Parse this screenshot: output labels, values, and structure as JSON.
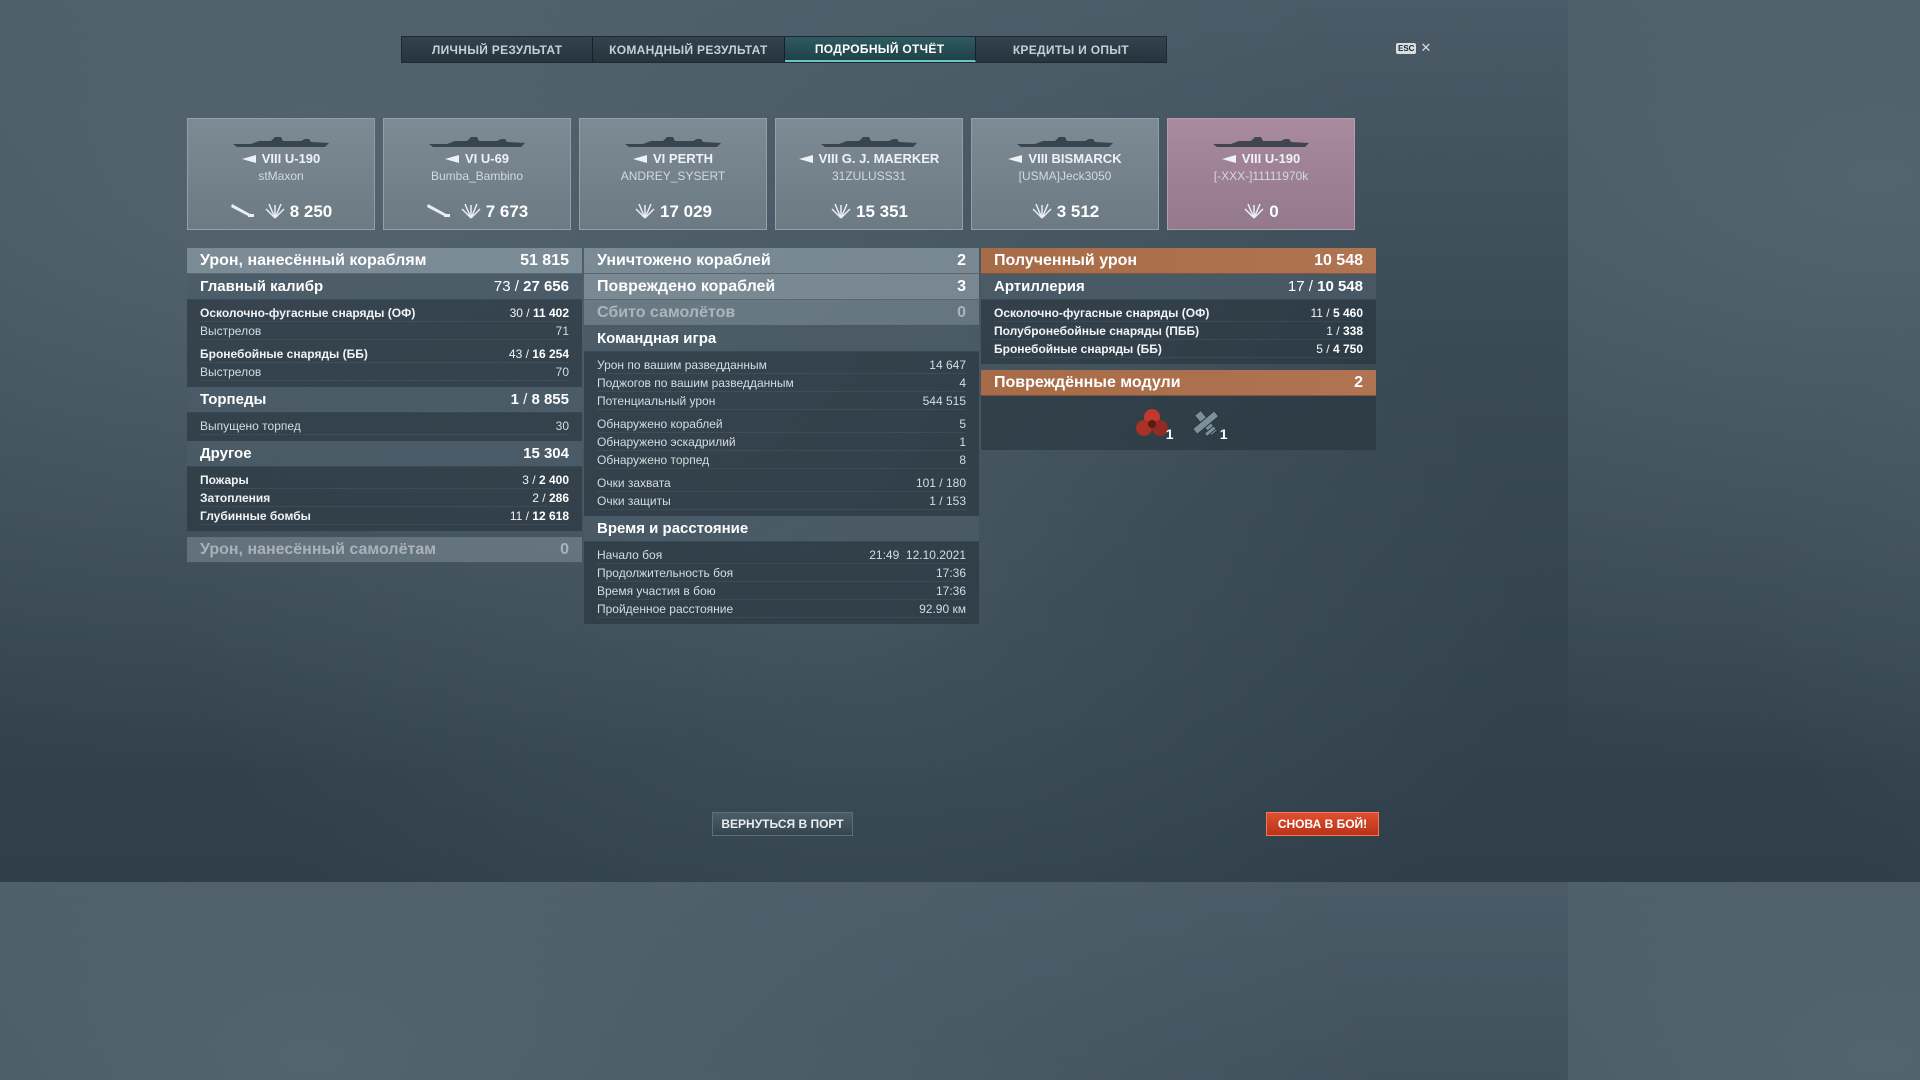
{
  "tabs": [
    "ЛИЧНЫЙ РЕЗУЛЬТАТ",
    "КОМАНДНЫЙ РЕЗУЛЬТАТ",
    "ПОДРОБНЫЙ ОТЧЁТ",
    "КРЕДИТЫ И ОПЫТ"
  ],
  "active_tab": "ПОДРОБНЫЙ ОТЧЁТ",
  "esc": {
    "badge": "ESC",
    "close": "✕"
  },
  "cards": [
    {
      "ship": "VIII U-190",
      "player": "stMaxon",
      "damage": "8 250",
      "own": false,
      "torpedo_icon": true
    },
    {
      "ship": "VI U-69",
      "player": "Bumba_Bambino",
      "damage": "7 673",
      "own": false,
      "torpedo_icon": true
    },
    {
      "ship": "VI PERTH",
      "player": "ANDREY_SYSERT",
      "damage": "17 029",
      "own": false,
      "torpedo_icon": false
    },
    {
      "ship": "VIII G. J. MAERKER",
      "player": "31ZULUSS31",
      "damage": "15 351",
      "own": false,
      "torpedo_icon": false
    },
    {
      "ship": "VIII BISMARCK",
      "player": "[USMA]Jeck3050",
      "damage": "3 512",
      "own": false,
      "torpedo_icon": false
    },
    {
      "ship": "VIII U-190",
      "player": "[-XXX-]11111970k",
      "damage": "0",
      "own": true,
      "torpedo_icon": false
    }
  ],
  "col1": {
    "ships_dmg": {
      "label": "Урон, нанесённый кораблям",
      "value": "51 815"
    },
    "main": {
      "label": "Главный калибр",
      "hits": "73",
      "value": "27 656"
    },
    "he": {
      "label": "Осколочно-фугасные снаряды (ОФ)",
      "hits": "30",
      "value": "11 402"
    },
    "he_shots": {
      "label": "Выстрелов",
      "value": "71"
    },
    "ap": {
      "label": "Бронебойные снаряды (ББ)",
      "hits": "43",
      "value": "16 254"
    },
    "ap_shots": {
      "label": "Выстрелов",
      "value": "70"
    },
    "torp": {
      "label": "Торпеды",
      "hits": "1",
      "value": "8 855"
    },
    "torp_launched": {
      "label": "Выпущено торпед",
      "value": "30"
    },
    "other": {
      "label": "Другое",
      "value": "15 304"
    },
    "fires": {
      "label": "Пожары",
      "hits": "3",
      "value": "2 400"
    },
    "floods": {
      "label": "Затопления",
      "hits": "2",
      "value": "286"
    },
    "depth": {
      "label": "Глубинные бомбы",
      "hits": "11",
      "value": "12 618"
    },
    "planes_dmg": {
      "label": "Урон, нанесённый самолётам",
      "value": "0"
    }
  },
  "col2": {
    "destroyed": {
      "label": "Уничтожено кораблей",
      "value": "2"
    },
    "damaged": {
      "label": "Повреждено кораблей",
      "value": "3"
    },
    "planes": {
      "label": "Сбито самолётов",
      "value": "0"
    },
    "team": {
      "label": "Командная игра"
    },
    "spot_dmg": {
      "label": "Урон по вашим разведданным",
      "value": "14 647"
    },
    "spot_fires": {
      "label": "Поджогов по вашим разведданным",
      "value": "4"
    },
    "potential": {
      "label": "Потенциальный урон",
      "value": "544 515"
    },
    "det_ships": {
      "label": "Обнаружено кораблей",
      "value": "5"
    },
    "det_squads": {
      "label": "Обнаружено эскадрилий",
      "value": "1"
    },
    "det_torps": {
      "label": "Обнаружено торпед",
      "value": "8"
    },
    "capture": {
      "label": "Очки захвата",
      "value": "101 / 180"
    },
    "defense": {
      "label": "Очки защиты",
      "value": "1 / 153"
    },
    "time": {
      "label": "Время и расстояние"
    },
    "start": {
      "label": "Начало боя",
      "value": "21:49  12.10.2021"
    },
    "duration": {
      "label": "Продолжительность боя",
      "value": "17:36"
    },
    "participation": {
      "label": "Время участия в бою",
      "value": "17:36"
    },
    "distance": {
      "label": "Пройденное расстояние",
      "value": "92.90 км"
    }
  },
  "col3": {
    "received": {
      "label": "Полученный урон",
      "value": "10 548"
    },
    "artillery": {
      "label": "Артиллерия",
      "hits": "17",
      "value": "10 548"
    },
    "he": {
      "label": "Осколочно-фугасные снаряды (ОФ)",
      "hits": "11",
      "value": "5 460"
    },
    "sap": {
      "label": "Полубронебойные снаряды (ПББ)",
      "hits": "1",
      "value": "338"
    },
    "ap": {
      "label": "Бронебойные снаряды (ББ)",
      "hits": "5",
      "value": "4 750"
    },
    "modules": {
      "label": "Повреждённые модули",
      "value": "2"
    },
    "module_items": [
      {
        "icon": "propeller-icon",
        "count": "1"
      },
      {
        "icon": "plane-module-icon",
        "count": "1"
      }
    ]
  },
  "buttons": {
    "port": "ВЕРНУТЬСЯ В ПОРТ",
    "battle": "СНОВА В БОЙ!"
  },
  "sep": " / "
}
